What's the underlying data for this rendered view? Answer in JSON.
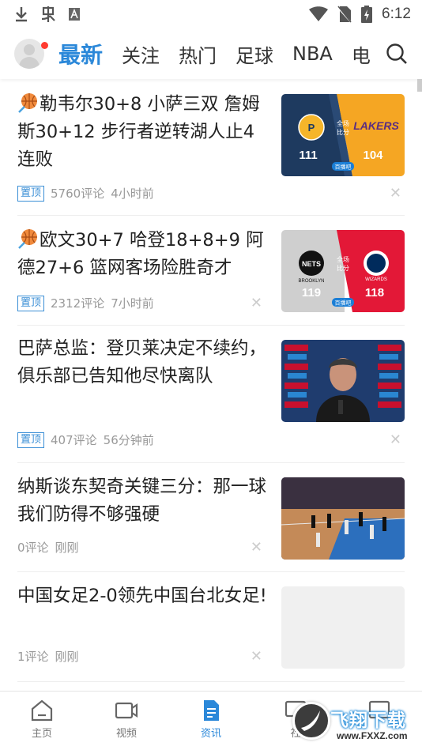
{
  "status_bar": {
    "time": "6:12"
  },
  "topnav": {
    "tabs": [
      {
        "label": "最新"
      },
      {
        "label": "关注"
      },
      {
        "label": "热门"
      },
      {
        "label": "足球"
      },
      {
        "label": "NBA"
      },
      {
        "label": "电"
      }
    ]
  },
  "feed": [
    {
      "title": "勒韦尔30+8 小萨三双 詹姆斯30+12 步行者逆转湖人止4连败",
      "badge": "置顶",
      "comments": "5760评论",
      "time": "4小时前",
      "thumb": {
        "left_team": "Pacers",
        "right_team": "LAKERS",
        "center_top": "全场",
        "center_bottom": "比分",
        "left_score": "111",
        "right_score": "104",
        "source": "百播吧"
      }
    },
    {
      "title": "欧文30+7 哈登18+8+9 阿德27+6 篮网客场险胜奇才",
      "badge": "置顶",
      "comments": "2312评论",
      "time": "7小时前",
      "thumb": {
        "left_team": "NETS",
        "left_sub": "BROOKLYN",
        "right_team": "WIZARDS",
        "center_top": "全场",
        "center_bottom": "比分",
        "left_score": "119",
        "right_score": "118",
        "source": "百播吧"
      }
    },
    {
      "title": "巴萨总监：登贝莱决定不续约，俱乐部已告知他尽快离队",
      "badge": "置顶",
      "comments": "407评论",
      "time": "56分钟前"
    },
    {
      "title": "纳斯谈东契奇关键三分：那一球我们防得不够强硬",
      "comments": "0评论",
      "time": "刚刚"
    },
    {
      "title": "中国女足2-0领先中国台北女足!",
      "comments": "1评论",
      "time": "刚刚"
    }
  ],
  "bottomnav": [
    {
      "label": "主页"
    },
    {
      "label": "视频"
    },
    {
      "label": "资讯"
    },
    {
      "label": "社"
    },
    {
      "label": ""
    }
  ],
  "watermark": {
    "title": "飞翔下载",
    "url": "www.FXXZ.com"
  },
  "colors": {
    "accent": "#2b88d9",
    "pacers": "#1e3a5f",
    "lakers": "#f5a623",
    "nets": "#cccccc",
    "wizards": "#e31837"
  }
}
